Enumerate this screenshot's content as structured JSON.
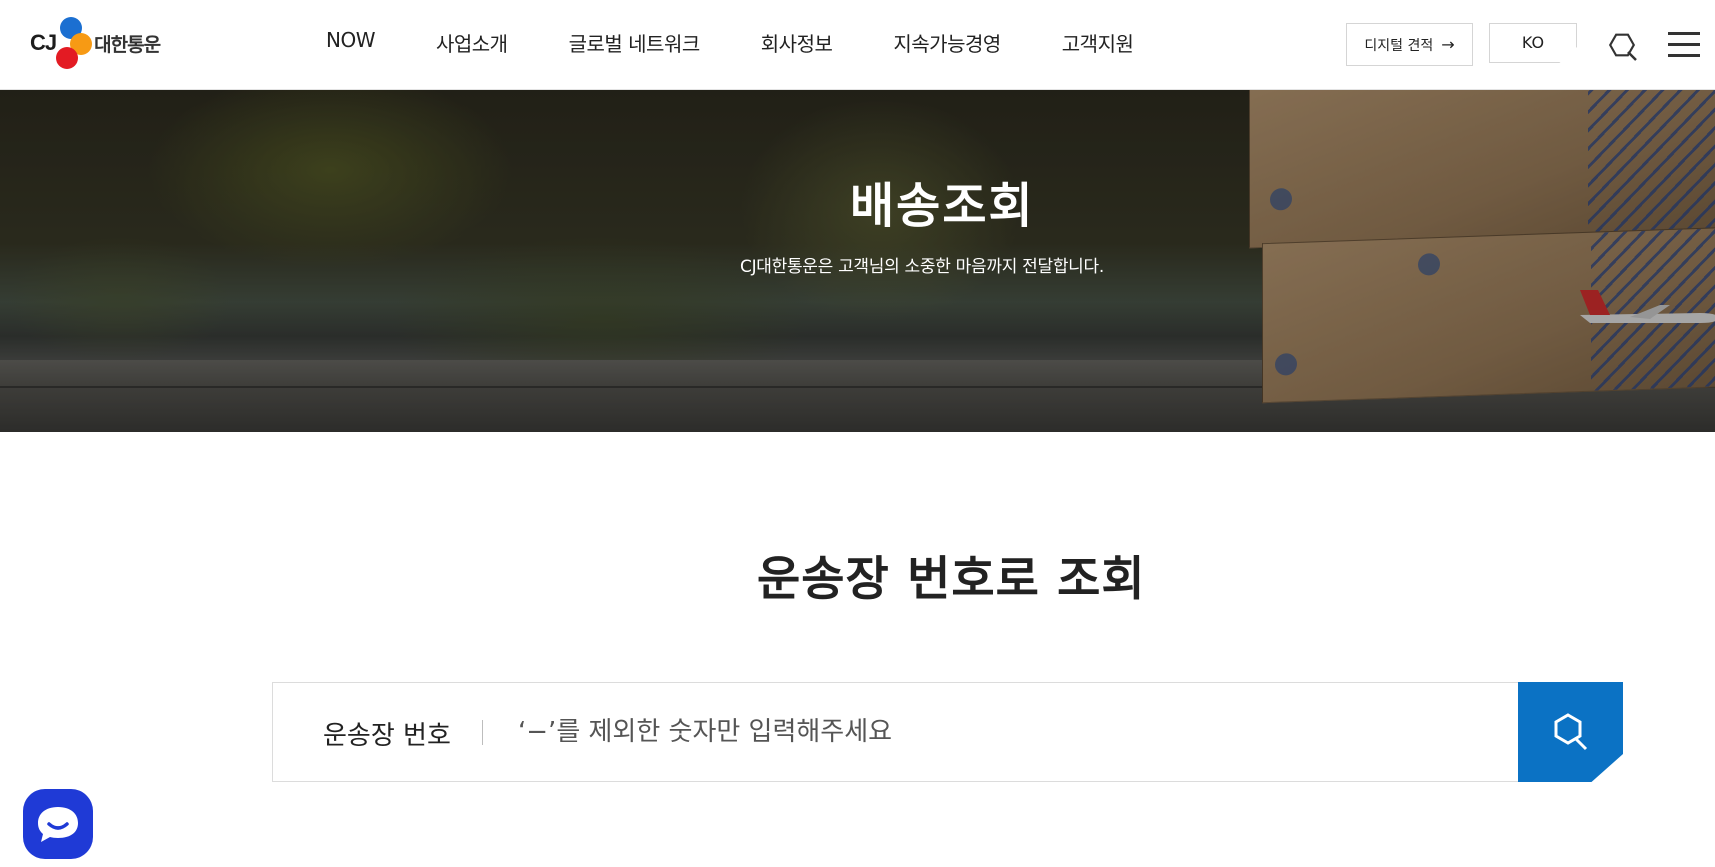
{
  "brand": {
    "logo_mark": "CJ",
    "logo_name": "대한통운"
  },
  "nav": {
    "items": [
      {
        "label": "NOW"
      },
      {
        "label": "사업소개"
      },
      {
        "label": "글로벌 네트워크"
      },
      {
        "label": "회사정보"
      },
      {
        "label": "지속가능경영"
      },
      {
        "label": "고객지원"
      }
    ]
  },
  "header": {
    "estimate_label": "디지털 견적",
    "estimate_icon": "arrow-right-icon",
    "lang_label": "KO",
    "search_icon": "search-icon",
    "menu_icon": "hamburger-menu-icon"
  },
  "hero": {
    "title": "배송조회",
    "subtitle": "CJ대한통운은 고객님의 소중한 마음까지 전달합니다."
  },
  "tracking": {
    "section_title": "운송장 번호로 조회",
    "field_label": "운송장 번호",
    "input_value": "",
    "input_placeholder": "‘−’를 제외한 숫자만 입력해주세요",
    "search_icon": "search-icon"
  },
  "chat": {
    "icon": "chat-bubble-icon"
  },
  "colors": {
    "accent": "#0b72c4",
    "chat": "#1f3ad6",
    "logo_blue": "#1b6fd1",
    "logo_orange": "#f79a14",
    "logo_red": "#e31b23"
  }
}
